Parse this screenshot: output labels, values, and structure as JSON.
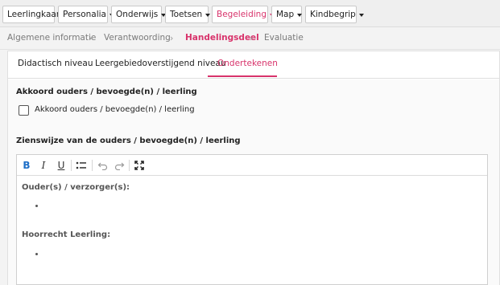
{
  "topnav": {
    "items": [
      {
        "label": "Leerlingkaart",
        "dropdown": false,
        "active": false
      },
      {
        "label": "Personalia",
        "dropdown": true,
        "active": false
      },
      {
        "label": "Onderwijs",
        "dropdown": true,
        "active": false
      },
      {
        "label": "Toetsen",
        "dropdown": true,
        "active": false
      },
      {
        "label": "Begeleiding",
        "dropdown": true,
        "active": true
      },
      {
        "label": "Map",
        "dropdown": true,
        "active": false
      },
      {
        "label": "Kindbegrip",
        "dropdown": true,
        "active": false
      }
    ]
  },
  "breadcrumb": {
    "items": [
      {
        "label": "Algemene informatie",
        "active": false
      },
      {
        "label": "Verantwoording",
        "active": false
      },
      {
        "label": "Handelingsdeel",
        "active": true
      },
      {
        "label": "Evaluatie",
        "active": false
      }
    ],
    "separator": "›"
  },
  "tabs": [
    {
      "label": "Didactisch niveau",
      "active": false
    },
    {
      "label": "Leergebiedoverstijgend niveau",
      "active": false
    },
    {
      "label": "Ondertekenen",
      "active": true
    }
  ],
  "agreement": {
    "title": "Akkoord ouders / bevoegde(n) / leerling",
    "checkbox_label": "Akkoord ouders / bevoegde(n) / leerling",
    "checked": false
  },
  "opinion": {
    "title": "Zienswijze van de ouders / bevoegde(n) / leerling"
  },
  "editor": {
    "toolbar": {
      "bold_icon": "B",
      "italic_icon": "I",
      "underline_icon": "U",
      "list_icon": "bullet-list-icon",
      "undo_icon": "undo-icon",
      "redo_icon": "redo-icon",
      "fullscreen_icon": "fullscreen-icon"
    },
    "heading1": "Ouder(s) / verzorger(s):",
    "heading2": "Hoorrecht Leerling:"
  },
  "colors": {
    "accent": "#d8336b",
    "bold_active": "#1e6fc8"
  }
}
